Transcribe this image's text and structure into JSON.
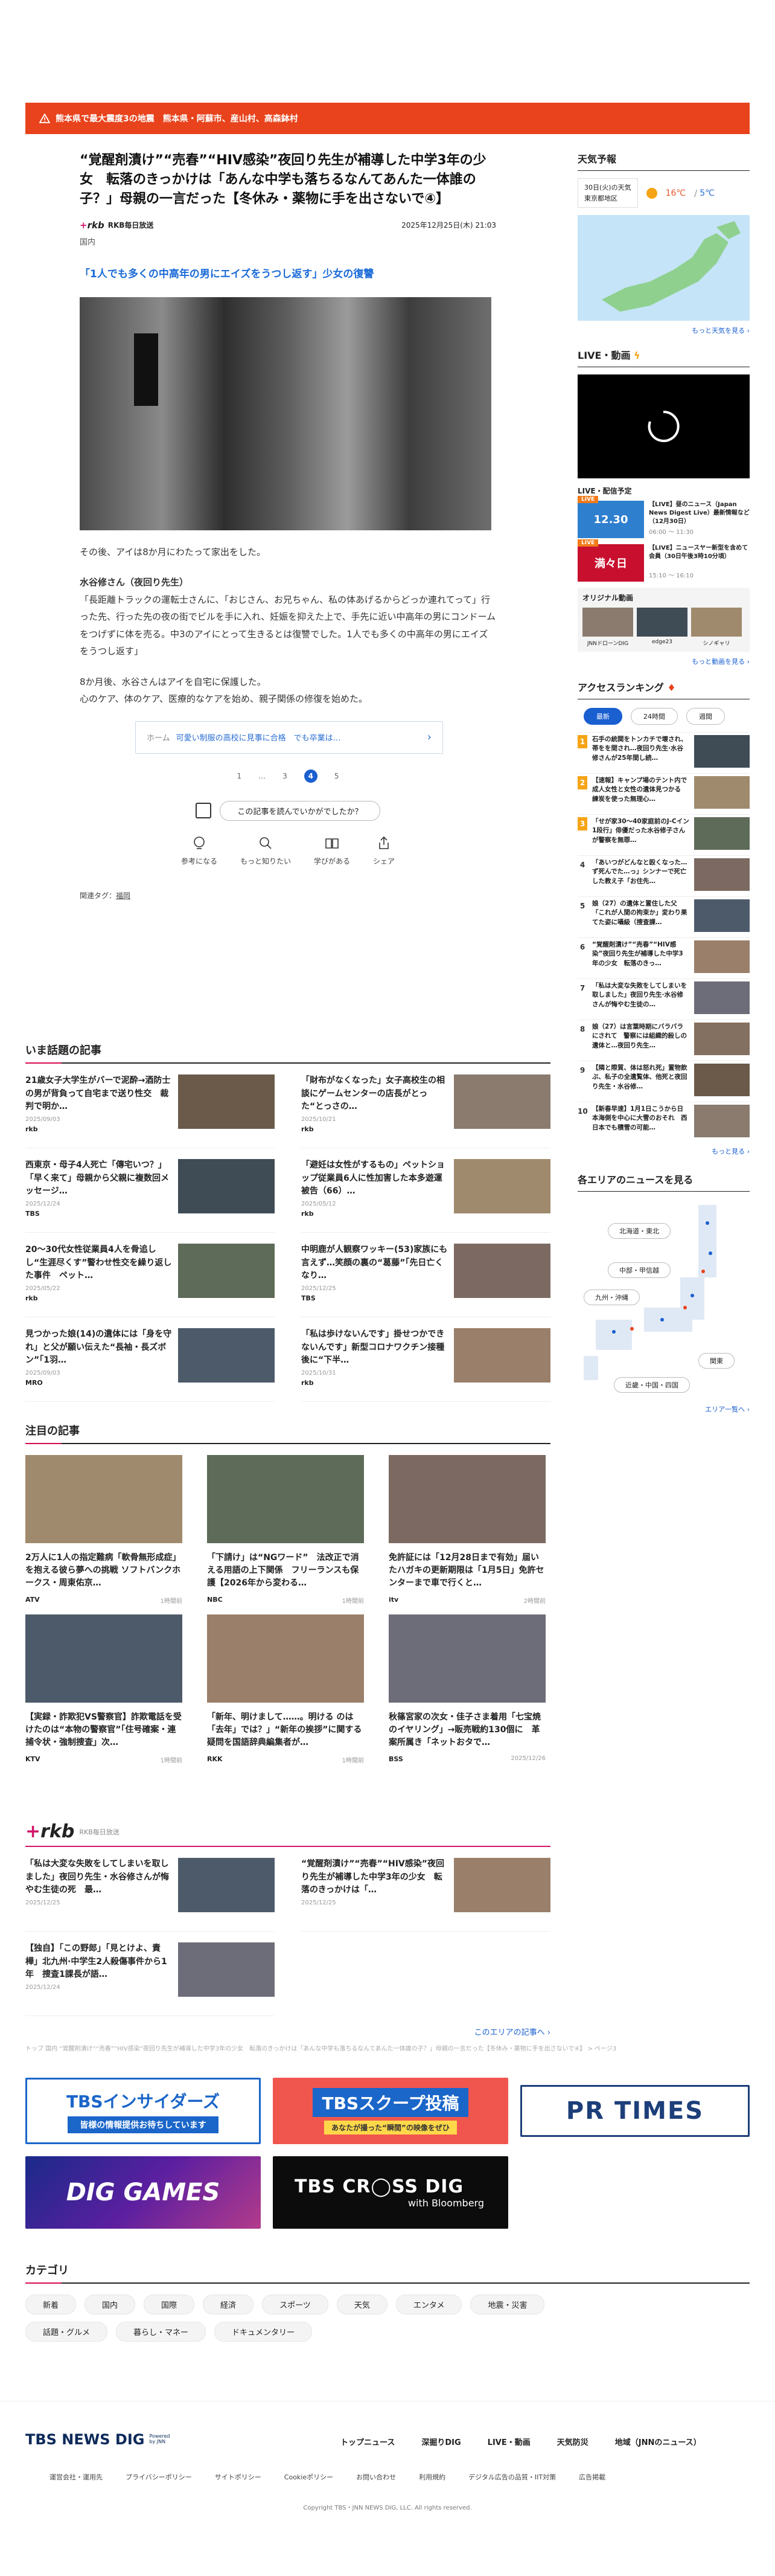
{
  "alert": {
    "text": "熊本県で最大震度3の地震　熊本県・阿蘇市、産山村、高森鉢村"
  },
  "article": {
    "title": "“覚醒剤漬け”“売春”“HIV感染”夜回り先生が補導した中学3年の少女　転落のきっかけは「あんな中学も落ちるなんてあんた一体誰の子？」母親の一言だった【冬休み・薬物に手を出さないで④】",
    "source": "RKB毎日放送",
    "category": "国内",
    "datetime": "2025年12月25日(木) 21:03",
    "headline": "「1人でも多くの中高年の男にエイズをうつし返す」少女の復讐",
    "p1": "その後、アイは8か月にわたって家出をした。",
    "sub": "水谷修さん（夜回り先生）",
    "p2": "「長距離トラックの運転士さんに、「おじさん、お兄ちゃん、私の体あげるからどっか連れてって」行った先、行った先の夜の街でビルを手に入れ、妊娠を抑えた上で、手先に近い中高年の男にコンドームをつげずに体を売る。中3のアイにとって生きるとは復讐でした。1人でも多くの中高年の男にエイズをうつし返す」",
    "p3a": "8か月後、水谷さんはアイを自宅に保護した。",
    "p3b": "心のケア、体のケア、医療的なケアを始め、親子関係の修復を始めた。",
    "next": {
      "label": "ホーム",
      "title": "可愛い制服の高校に見事に合格　でも卒業は…"
    },
    "pages": [
      "1",
      "…",
      "3",
      "4",
      "5"
    ],
    "feedback": "この記事を読んでいかがでしたか？",
    "reactions": [
      "参考になる",
      "もっと知りたい",
      "学びがある",
      "シェア"
    ],
    "tags_label": "関連タグ：",
    "tag": "福岡"
  },
  "trending": {
    "title": "いま話題の記事",
    "items": [
      {
        "t": "21歳女子大学生がバーで泥酔→酒防士の男が背負って自宅まで送り性交　裁判で明か…",
        "d": "2025/09/03",
        "logo": "rkb"
      },
      {
        "t": "「財布がなくなった」女子高校生の相談にゲームセンターの店長がとった“とっさの…",
        "d": "2025/10/21",
        "logo": "rkb"
      },
      {
        "t": "西東京・母子4人死亡「傳宅いつ？」「早く来て」母親から父親に複数回メッセージ…",
        "d": "2025/12/24",
        "logo": "TBS"
      },
      {
        "t": "「避妊は女性がするもの」ペットショップ従業員6人に性加害した本多遊運被告（66）…",
        "d": "2025/05/12",
        "logo": "rkb"
      },
      {
        "t": "20～30代女性従業員4人を骨追しし“生涯尽くす”警わせ性交を繰り返した事件　ペット…",
        "d": "2025/05/22",
        "logo": "rkb"
      },
      {
        "t": "中明鹿が人観察ワッキー(53)家族にも言えず…笑顔の裏の“葛藤”「先日亡くなり…",
        "d": "2025/12/25",
        "logo": "TBS"
      },
      {
        "t": "見つかった娘(14)の遺体には「身を守れ」と父が願い伝えた“長袖・長ズボン”「1羽…",
        "d": "2025/09/03",
        "logo": "MRO"
      },
      {
        "t": "「私は歩けないんです」掛せつかできないんです」新型コロナワクチン接種後に“下半…",
        "d": "2025/10/31",
        "logo": "rkb"
      }
    ]
  },
  "attention": {
    "title": "注目の記事",
    "items": [
      {
        "t": "2万人に1人の指定難病「軟骨無形成症」を抱える彼ら夢への挑戦 ソフトバンクホークス・周東佑京…",
        "d": "1時間前",
        "logo": "ATV"
      },
      {
        "t": "「下請け」は“NGワード”　法改正で消える用語の上下関係　フリーランスも保護【2026年から変わる…",
        "d": "1時間前",
        "logo": "NBC"
      },
      {
        "t": "免許証には「12月28日まで有効」届いたハガキの更新期限は「1月5日」免許センターまで車で行くと…",
        "d": "2時間前",
        "logo": "itv"
      },
      {
        "t": "【実録・詐欺犯VS警察官】詐欺電話を受けたのは“本物の警察官”「住号確案・連捕令状・強制捜査」次…",
        "d": "1時間前",
        "logo": "KTV"
      },
      {
        "t": "「新年、明けまして……。明ける のは「去年」では？」“新年の挨拶”に関する疑問を国語辞典編集者が…",
        "d": "1時間前",
        "logo": "RKK"
      },
      {
        "t": "秋篠宮家の次女・佳子さま着用「七宝焼のイヤリング」→販売戦約130個に　革案所属き「ネットおタで…",
        "d": "2025/12/26",
        "logo": "BSS"
      }
    ]
  },
  "rkb_section": {
    "name": "RKB毎日放送",
    "items": [
      {
        "t": "「私は大変な失敗をしてしまいを取しました」夜回り先生・水谷修さんが悔やむ生徒の死　最…",
        "d": "2025/12/25"
      },
      {
        "t": "“覚醒剤漬け”“売春”“HIV感染”夜回り先生が補導した中学3年の少女　転落のきっかけは「…",
        "d": "2025/12/25"
      },
      {
        "t": "【独自】「この野郎」「見とけよ、責樺」北九州·中学生2人殺傷事件から1年　捜査1課長が語…",
        "d": "2025/12/24"
      }
    ],
    "more": "このエリアの記事へ ›"
  },
  "breadcrumb": "トップ 国内 “覚醒剤漬け”“売春”“HIV感染”夜回り先生が補導した中学3年の少女　転落のきっかけは「あんな中学も落ちるなんてあんた一体誰の子？」母親の一言だった【冬休み・薬物に手を出さないで④】 > ページ3",
  "banners": {
    "insiders_title": "TBSインサイダーズ",
    "insiders_sub": "皆様の情報提供お待ちしています",
    "scoop_title": "TBSスクープ投稿",
    "scoop_sub": "あなたが撮った“瞬間”の映像をぜひ",
    "prtimes": "PR TIMES",
    "diggames": "DIG GAMES",
    "crossdig": "TBS CR◯SS DIG",
    "crossdig_sub": "with Bloomberg"
  },
  "categories": {
    "title": "カテゴリ",
    "items": [
      "新着",
      "国内",
      "国際",
      "経済",
      "スポーツ",
      "天気",
      "エンタメ",
      "地震・災害",
      "話題・グルメ",
      "暮らし・マネー",
      "ドキュメンタリー"
    ]
  },
  "footer": {
    "logo": "TBS NEWS DIG",
    "powered": "Powered by JNN",
    "nav": [
      "トップニュース",
      "深掘りDIG",
      "LIVE・動画",
      "天気防災",
      "地域（JNNのニュース）"
    ],
    "sub": [
      "運営会社・運用先",
      "プライバシーポリシー",
      "サイトポリシー",
      "Cookieポリシー",
      "お問い合わせ",
      "利用規約",
      "デジタル広告の品質・IIT対策",
      "広告掲載"
    ],
    "copy": "Copyright TBS・JNN NEWS DIG, LLC. All rights reserved."
  },
  "sidebar": {
    "weather": {
      "title": "天気予報",
      "date": "30日(火)の天気",
      "place": "東京都地区",
      "hi": "16℃",
      "lo": "5℃",
      "more": "もっと天気を見る ›"
    },
    "live": {
      "title": "LIVE・動画",
      "sched_title": "LIVE・配信予定",
      "items": [
        {
          "badge": "LIVE",
          "time_label": "12.30",
          "t": "【LIVE】昼のニュース（Japan News Digest Live）最新情報など（12月30日）",
          "time": "06:00 ～ 11:30"
        },
        {
          "badge": "LIVE",
          "time_label": "満々日",
          "t": "【LIVE】ニュースヤー新型を含めて会員（30日午後3時10分頃）",
          "time": "15:10 ～ 16:10"
        }
      ],
      "orig_title": "オリジナル動画",
      "orig": [
        "JNNドローンDIG",
        "edge23",
        "シノギャリ"
      ],
      "more": "もっと動画を見る ›"
    },
    "ranking": {
      "title": "アクセスランキング",
      "tabs": [
        "最新",
        "24時間",
        "週間"
      ],
      "items": [
        {
          "n": "1",
          "t": "石手の統関をトンカチで壊され、帯をを間され…夜回り先生·水谷修さんが25年間し続…"
        },
        {
          "n": "2",
          "t": "【速報】キャンプ場のテント内で成人女性と女性の遺体見つかる　練炭を使った無理心…"
        },
        {
          "n": "3",
          "t": "「せが家30〜40家庭前のJ-Cイン1段行」俳優だった水谷修子さんが警察を無罪…"
        },
        {
          "n": "4",
          "t": "「あいつがどんなと殴くなった…ず死んでた…っ」シンナーで死亡した教え子「お住先…"
        },
        {
          "n": "5",
          "t": "娘（27）の遺体と置住した父「これが人間の拘束か」変わり果てた姿に囁級（捜査課…"
        },
        {
          "n": "6",
          "t": "“覚醒剤漬け”“売春”“HIV感染”夜回り先生が補導した中学3年の少女　転落のきっ…"
        },
        {
          "n": "7",
          "t": "「私は大変な失敗をしてしまいを取しました」夜回り先生·水谷修さんが悔やむ生徒の…"
        },
        {
          "n": "8",
          "t": "娘（27）は言葉時期にバラバラにされて　警察には組織的殺しの遺体と…夜回り先生…"
        },
        {
          "n": "9",
          "t": "【隣と際質、体は怒れ死」置物飲ぶ、私子の全遺覧体、他死と夜回り先生・水谷修…"
        },
        {
          "n": "10",
          "t": "【新春早速】1月1日こうから日本海側を中心に大雪のおそれ　西日本でも積雪の可能…"
        }
      ],
      "more": "もっと見る ›"
    },
    "area": {
      "title": "各エリアのニュースを見る",
      "regions": [
        "北海道・東北",
        "中部・甲信越",
        "九州・沖縄",
        "関東",
        "近畿・中国・四国"
      ],
      "more": "エリア一覧へ ›"
    }
  },
  "colors": {
    "accent": "#d60b52",
    "blue": "#1a5fd0",
    "alert": "#e8431c"
  }
}
